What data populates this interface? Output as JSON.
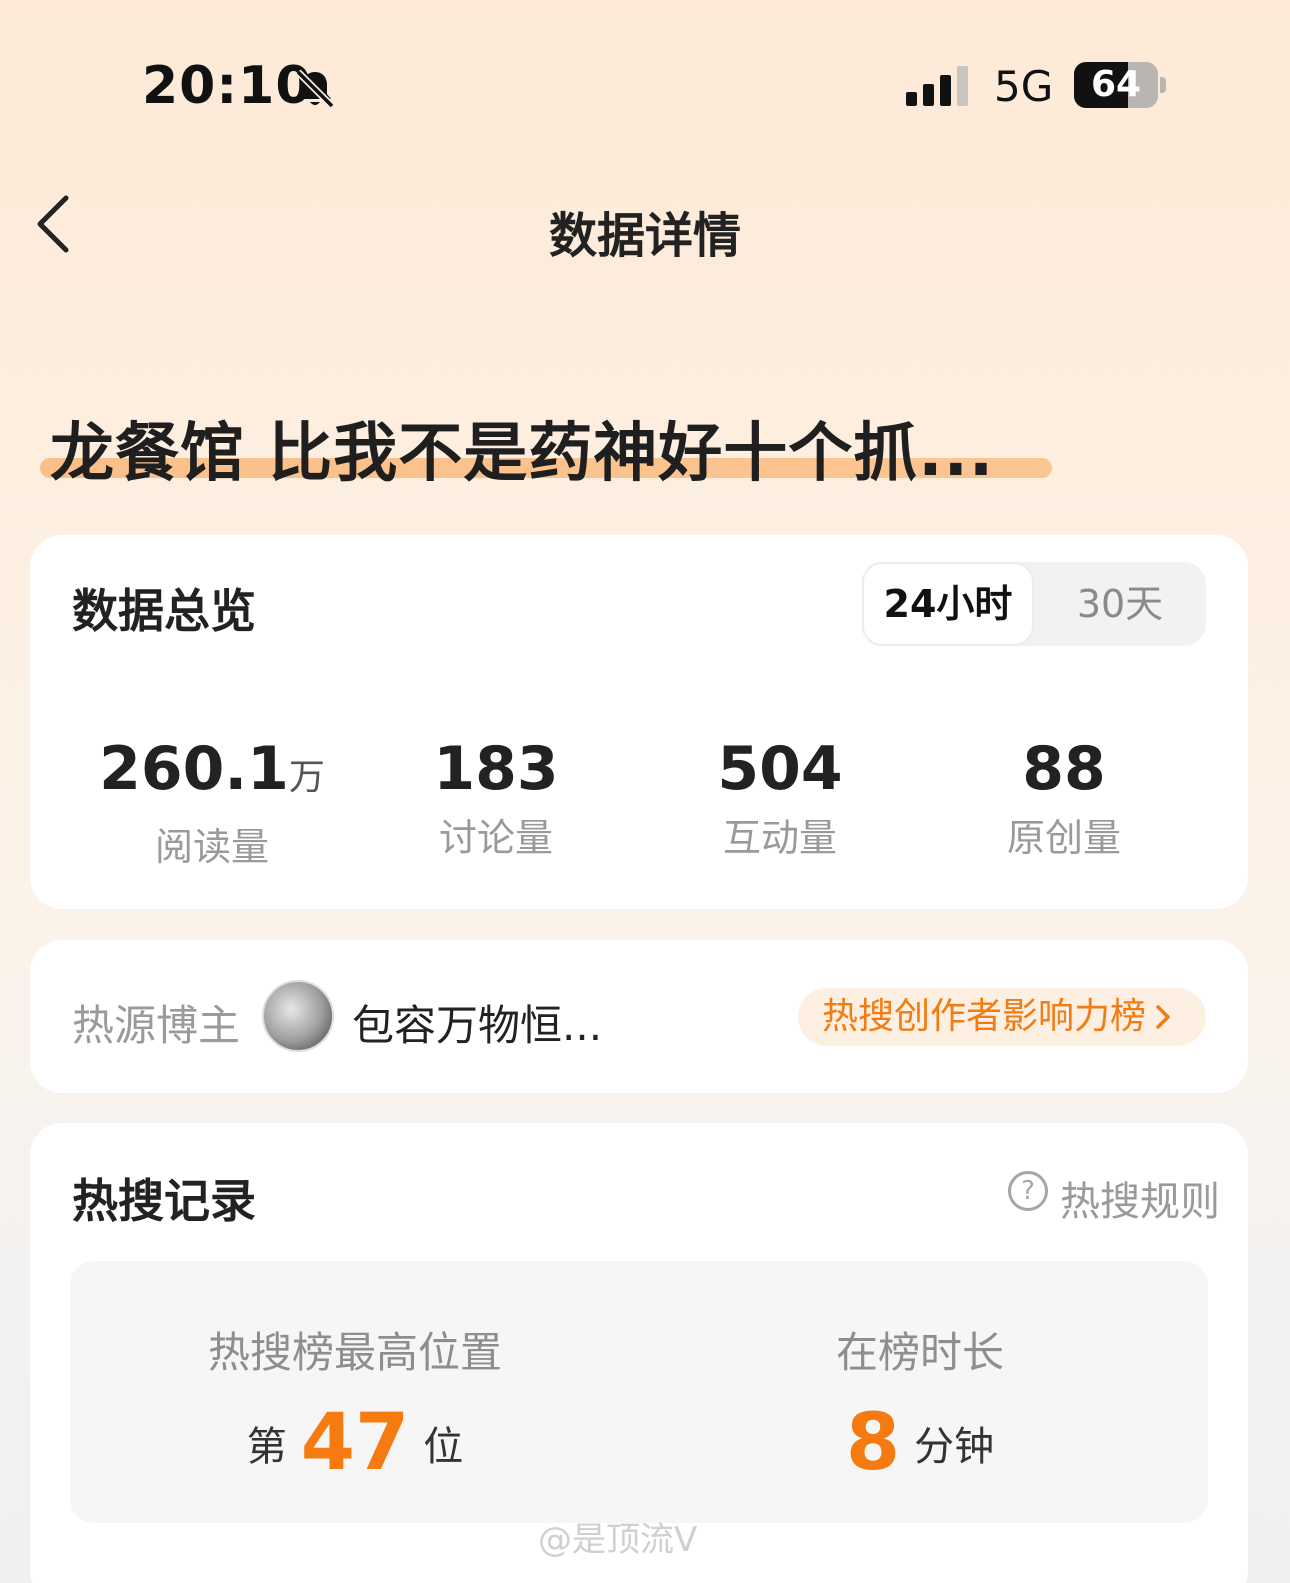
{
  "status_bar": {
    "time": "20:10",
    "icons": [
      "bell-slash-icon",
      "signal-icon"
    ],
    "network": "5G",
    "battery": 64
  },
  "nav": {
    "title": "数据详情",
    "back_icon": "chevron-left-icon"
  },
  "topic": {
    "title": "龙餐馆 比我不是药神好十个抓...",
    "underline_color": "#fbc08a"
  },
  "overview": {
    "heading": "数据总览",
    "tabs": [
      {
        "label": "24小时",
        "selected": true
      },
      {
        "label": "30天",
        "selected": false
      }
    ],
    "metrics": [
      {
        "value": "260.1",
        "unit": "万",
        "label": "阅读量"
      },
      {
        "value": "183",
        "unit": "",
        "label": "讨论量"
      },
      {
        "value": "504",
        "unit": "",
        "label": "互动量"
      },
      {
        "value": "88",
        "unit": "",
        "label": "原创量"
      }
    ]
  },
  "source": {
    "label": "热源博主",
    "name": "包容万物恒...",
    "rank_link": "热搜创作者影响力榜"
  },
  "records": {
    "heading": "热搜记录",
    "rule_link": "热搜规则",
    "peak": {
      "label": "热搜榜最高位置",
      "prefix": "第",
      "value": "47",
      "suffix": "位"
    },
    "duration": {
      "label": "在榜时长",
      "value": "8",
      "suffix": "分钟"
    }
  },
  "colors": {
    "accent": "#f57a0f",
    "pill_bg": "#fdf0e3"
  },
  "watermark": "@是顶流V"
}
